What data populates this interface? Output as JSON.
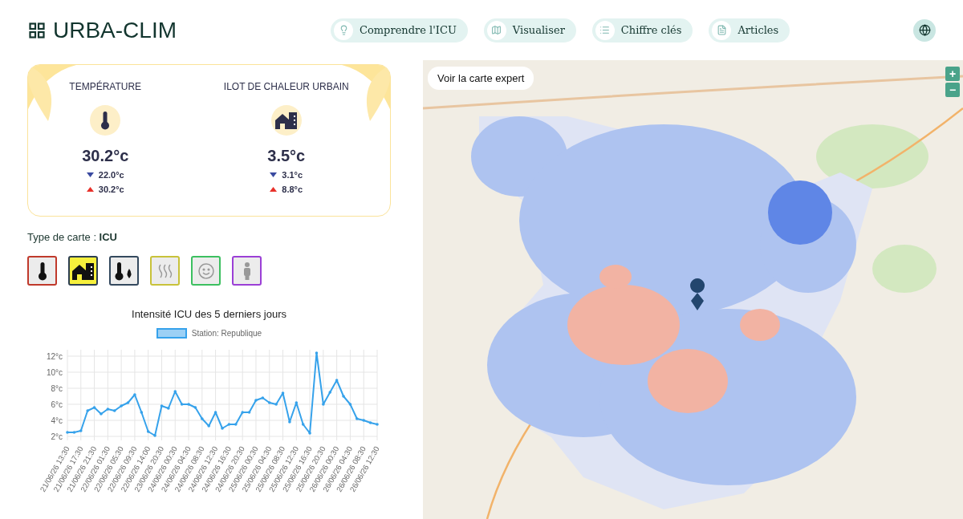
{
  "header": {
    "logo": "URBA-CLIM",
    "nav": [
      {
        "label": "Comprendre l'ICU",
        "kind": "bulb"
      },
      {
        "label": "Visualiser",
        "kind": "map"
      },
      {
        "label": "Chiffre clés",
        "kind": "list"
      },
      {
        "label": "Articles",
        "kind": "doc"
      }
    ]
  },
  "stats": [
    {
      "title": "TEMPÉRATURE",
      "kind": "thermometer",
      "value": "30.2°c",
      "min": "22.0°c",
      "max": "30.2°c"
    },
    {
      "title": "ILOT DE CHALEUR URBAIN",
      "kind": "building",
      "value": "3.5°c",
      "min": "3.1°c",
      "max": "8.8°c"
    }
  ],
  "map_type": {
    "label": "Type de carte : **ICU**"
  },
  "map_types": [
    {
      "kind": "thermometer",
      "color": "#c0392b",
      "selected": false
    },
    {
      "kind": "building",
      "color": "#2c3e50",
      "selected": true
    },
    {
      "kind": "humidity",
      "color": "#34495e",
      "selected": false
    },
    {
      "kind": "heat",
      "color": "#c8c23a",
      "selected": false
    },
    {
      "kind": "comfort",
      "color": "#3cc060",
      "selected": false
    },
    {
      "kind": "person",
      "color": "#9b3fd6",
      "selected": false
    }
  ],
  "chart": {
    "chart_data": {
      "type": "line",
      "grid": true,
      "title": "Intensité ICU des 5 derniers jours",
      "ylim": [
        1.5,
        12.8
      ],
      "yticks": [
        {
          "value": 2,
          "label": "2°c"
        },
        {
          "value": 4,
          "label": "4°c"
        },
        {
          "value": 6,
          "label": "6°c"
        },
        {
          "value": 8,
          "label": "8°c"
        },
        {
          "value": 10,
          "label": "10°c"
        },
        {
          "value": 12,
          "label": "12°c"
        }
      ],
      "categories": [
        "21/06/26 13:30",
        null,
        "21/06/26 17:30",
        null,
        "21/06/26 21:30",
        null,
        "22/06/26 01:30",
        null,
        "22/06/26 05:30",
        null,
        "22/06/26 09:30",
        null,
        "22/06/26 14:00",
        null,
        "23/06/26 20:30",
        null,
        "24/06/26 00:30",
        null,
        "24/06/26 04:30",
        null,
        "24/06/26 08:30",
        null,
        "24/06/26 12:30",
        null,
        "24/06/26 16:30",
        null,
        "24/06/26 20:30",
        null,
        "25/06/26 00:30",
        null,
        "25/06/26 04:30",
        null,
        "25/06/26 08:30",
        null,
        "25/06/26 12:30",
        null,
        "25/06/26 16:30",
        null,
        "25/06/26 20:30",
        null,
        "26/06/26 00:30",
        null,
        "26/06/26 04:30",
        null,
        "26/06/26 08:30",
        null,
        "26/06/26 12:30"
      ],
      "series": [
        {
          "name": "Station: Republique",
          "color": "#36a2eb",
          "values": [
            2.5,
            2.5,
            2.7,
            5.2,
            5.6,
            4.8,
            5.4,
            5.2,
            5.8,
            6.2,
            7.2,
            5.0,
            2.6,
            2.1,
            5.8,
            5.5,
            7.6,
            6.0,
            6.0,
            5.6,
            4.2,
            3.3,
            5.0,
            3.0,
            3.5,
            3.5,
            5.0,
            5.0,
            6.5,
            6.8,
            6.2,
            6.0,
            7.4,
            3.8,
            6.2,
            3.5,
            2.4,
            12.4,
            6.0,
            7.5,
            9.0,
            7.0,
            6.0,
            4.2,
            4.0,
            3.7,
            3.5
          ]
        }
      ]
    }
  },
  "map": {
    "kind": "picture",
    "expert_button": "Voir la carte expert",
    "zoom_in": "+",
    "zoom_out": "−"
  }
}
